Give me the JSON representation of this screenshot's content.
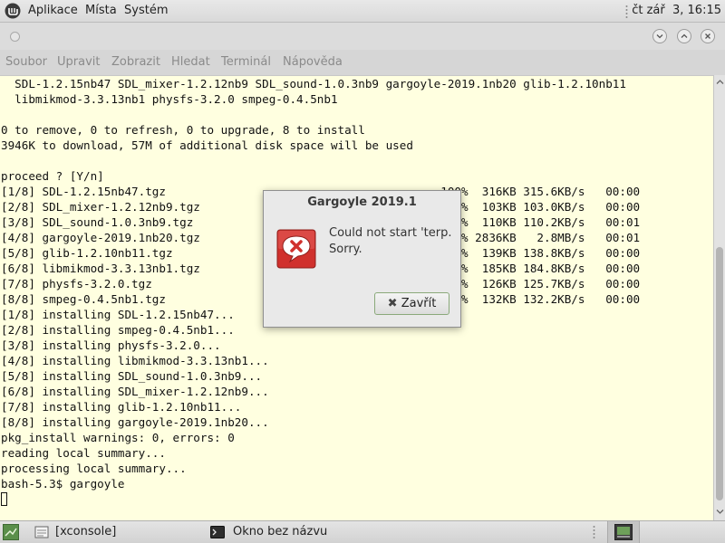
{
  "topbar": {
    "menus": [
      "Aplikace",
      "Místa",
      "Systém"
    ],
    "clock": "čt zář  3, 16:15"
  },
  "terminal_menu": [
    "Soubor",
    "Upravit",
    "Zobrazit",
    "Hledat",
    "Terminál",
    "Nápověda"
  ],
  "terminal_lines": [
    "  SDL-1.2.15nb47 SDL_mixer-1.2.12nb9 SDL_sound-1.0.3nb9 gargoyle-2019.1nb20 glib-1.2.10nb11",
    "  libmikmod-3.3.13nb1 physfs-3.2.0 smpeg-0.4.5nb1",
    "",
    "0 to remove, 0 to refresh, 0 to upgrade, 8 to install",
    "3946K to download, 57M of additional disk space will be used",
    "",
    "proceed ? [Y/n]",
    "[1/8] SDL-1.2.15nb47.tgz                                        100%  316KB 315.6KB/s   00:00",
    "[2/8] SDL_mixer-1.2.12nb9.tgz                                   100%  103KB 103.0KB/s   00:00",
    "[3/8] SDL_sound-1.0.3nb9.tgz                                    100%  110KB 110.2KB/s   00:01",
    "[4/8] gargoyle-2019.1nb20.tgz                                   100% 2836KB   2.8MB/s   00:01",
    "[5/8] glib-1.2.10nb11.tgz                                       100%  139KB 138.8KB/s   00:00",
    "[6/8] libmikmod-3.3.13nb1.tgz                                   100%  185KB 184.8KB/s   00:00",
    "[7/8] physfs-3.2.0.tgz                                          100%  126KB 125.7KB/s   00:00",
    "[8/8] smpeg-0.4.5nb1.tgz                                        100%  132KB 132.2KB/s   00:00",
    "[1/8] installing SDL-1.2.15nb47...",
    "[2/8] installing smpeg-0.4.5nb1...",
    "[3/8] installing physfs-3.2.0...",
    "[4/8] installing libmikmod-3.3.13nb1...",
    "[5/8] installing SDL_sound-1.0.3nb9...",
    "[6/8] installing SDL_mixer-1.2.12nb9...",
    "[7/8] installing glib-1.2.10nb11...",
    "[8/8] installing gargoyle-2019.1nb20...",
    "pkg_install warnings: 0, errors: 0",
    "reading local summary...",
    "processing local summary...",
    "bash-5.3$ gargoyle"
  ],
  "dialog": {
    "title": "Gargoyle 2019.1",
    "message_line1": "Could not start 'terp.",
    "message_line2": "Sorry.",
    "button_label": "Zavřít",
    "icon": "error-icon"
  },
  "taskbar": {
    "items": [
      "[xconsole]",
      "Okno bez názvu"
    ]
  },
  "colors": {
    "terminal_bg": "#ffffe0",
    "error_red": "#d0312d",
    "button_border": "#8aa97a"
  }
}
